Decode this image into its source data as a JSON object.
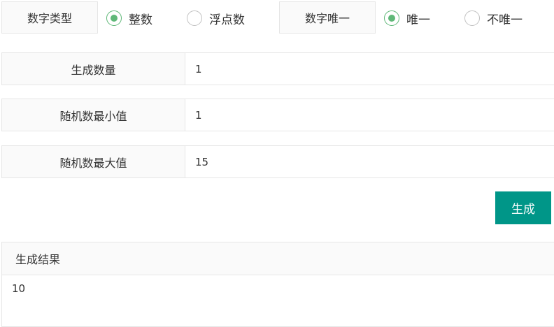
{
  "options": {
    "number_type_label": "数字类型",
    "number_type_choices": [
      {
        "label": "整数",
        "checked": true
      },
      {
        "label": "浮点数",
        "checked": false
      }
    ],
    "unique_label": "数字唯一",
    "unique_choices": [
      {
        "label": "唯一",
        "checked": true
      },
      {
        "label": "不唯一",
        "checked": false
      }
    ]
  },
  "form": {
    "count_label": "生成数量",
    "count_value": "1",
    "min_label": "随机数最小值",
    "min_value": "1",
    "max_label": "随机数最大值",
    "max_value": "15"
  },
  "actions": {
    "generate_label": "生成"
  },
  "result": {
    "header": "生成结果",
    "value": "10"
  },
  "colors": {
    "accent": "#009688",
    "radio_checked": "#5fb878"
  }
}
